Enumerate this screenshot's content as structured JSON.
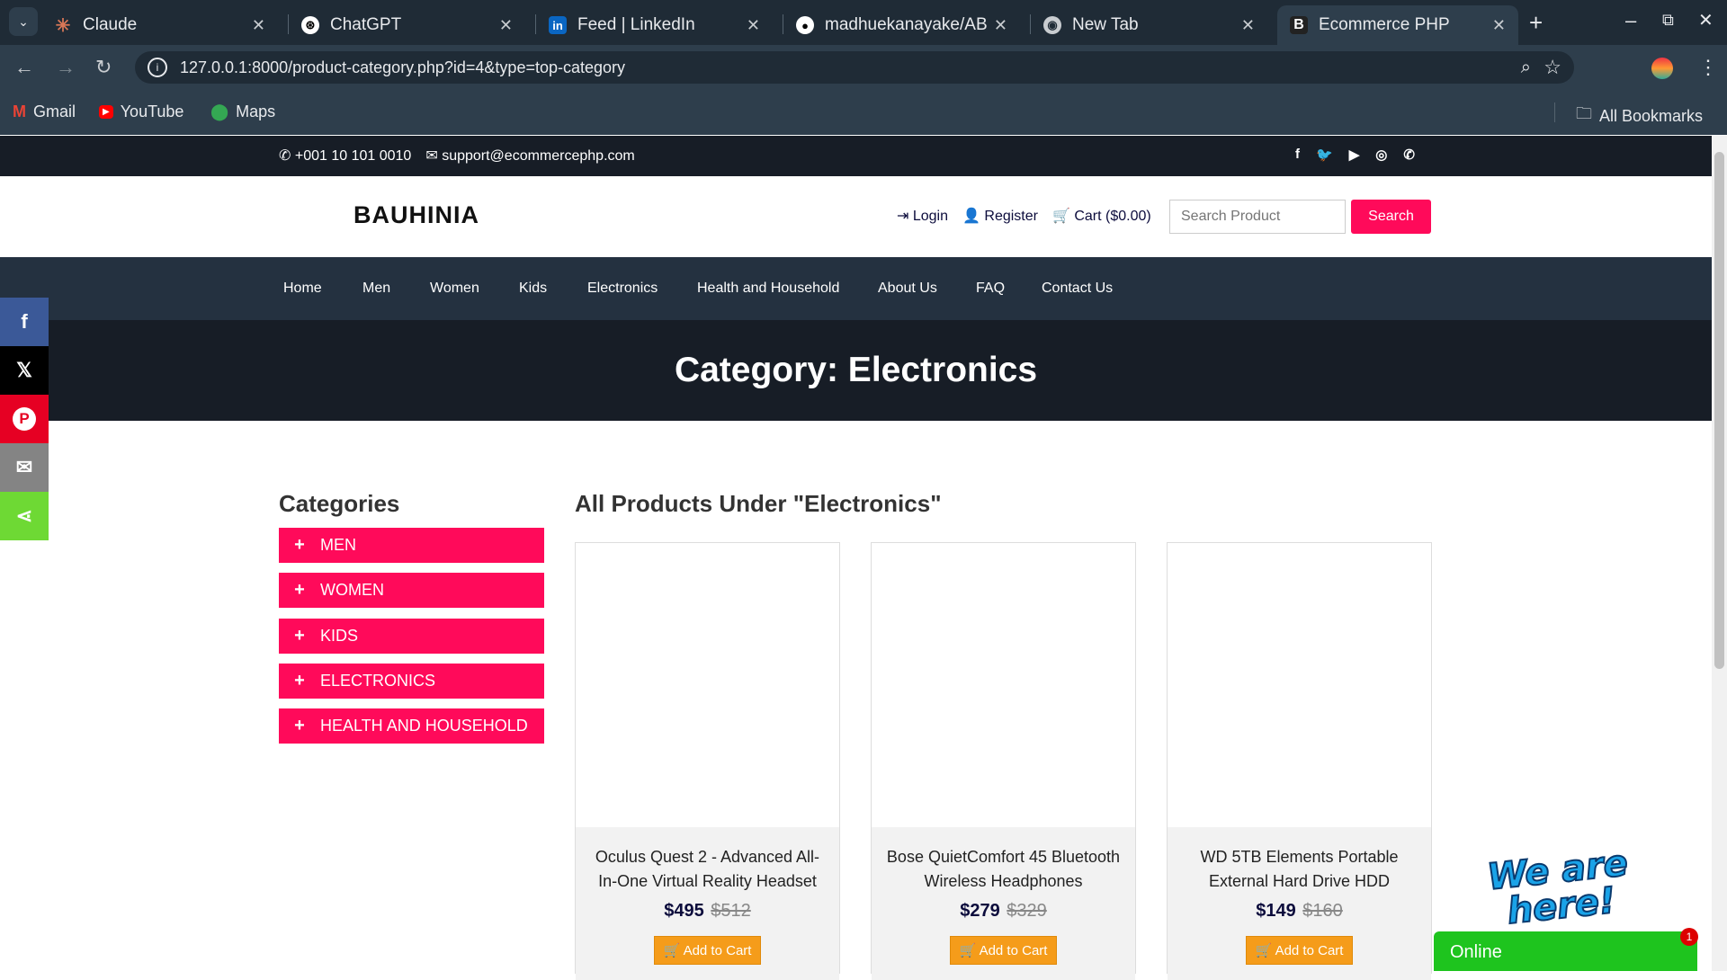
{
  "browser": {
    "tabs": [
      {
        "title": "Claude",
        "icon": "claude-icon"
      },
      {
        "title": "ChatGPT",
        "icon": "chatgpt-icon"
      },
      {
        "title": "Feed | LinkedIn",
        "icon": "linkedin-icon"
      },
      {
        "title": "madhuekanayake/ABC",
        "icon": "github-icon"
      },
      {
        "title": "New Tab",
        "icon": "chrome-icon"
      },
      {
        "title": "Ecommerce PHP",
        "icon": "bootstrap-icon"
      }
    ],
    "url": "127.0.0.1:8000/product-category.php?id=4&type=top-category",
    "bookmarks": [
      "Gmail",
      "YouTube",
      "Maps"
    ],
    "all_bookmarks": "All Bookmarks"
  },
  "topbar": {
    "phone": "+001 10 101 0010",
    "email": "support@ecommercephp.com"
  },
  "header": {
    "logo": "BAUHINIA",
    "login": "Login",
    "register": "Register",
    "cart": "Cart ($0.00)",
    "search_placeholder": "Search Product",
    "search_button": "Search"
  },
  "nav": [
    "Home",
    "Men",
    "Women",
    "Kids",
    "Electronics",
    "Health and Household",
    "About Us",
    "FAQ",
    "Contact Us"
  ],
  "banner": {
    "title": "Category: Electronics"
  },
  "sidebar": {
    "heading": "Categories",
    "items": [
      "MEN",
      "WOMEN",
      "KIDS",
      "ELECTRONICS",
      "HEALTH AND HOUSEHOLD"
    ]
  },
  "products": {
    "heading": "All Products Under \"Electronics\"",
    "items": [
      {
        "name": "Oculus Quest 2 - Advanced All-In-One Virtual Reality Headset",
        "price": "$495",
        "old_price": "$512",
        "button": "Add to Cart"
      },
      {
        "name": "Bose QuietComfort 45 Bluetooth Wireless Headphones",
        "price": "$279",
        "old_price": "$329",
        "button": "Add to Cart"
      },
      {
        "name": "WD 5TB Elements Portable External Hard Drive HDD",
        "price": "$149",
        "old_price": "$160",
        "button": "Add to Cart"
      }
    ]
  },
  "chat": {
    "status": "Online",
    "badge": "1",
    "callout": "We are here!"
  },
  "colors": {
    "accent": "#ff0a5a",
    "dark": "#171d26",
    "nav": "#243140",
    "cart_button": "#f59c1a",
    "chat_green": "#1ec41e"
  }
}
